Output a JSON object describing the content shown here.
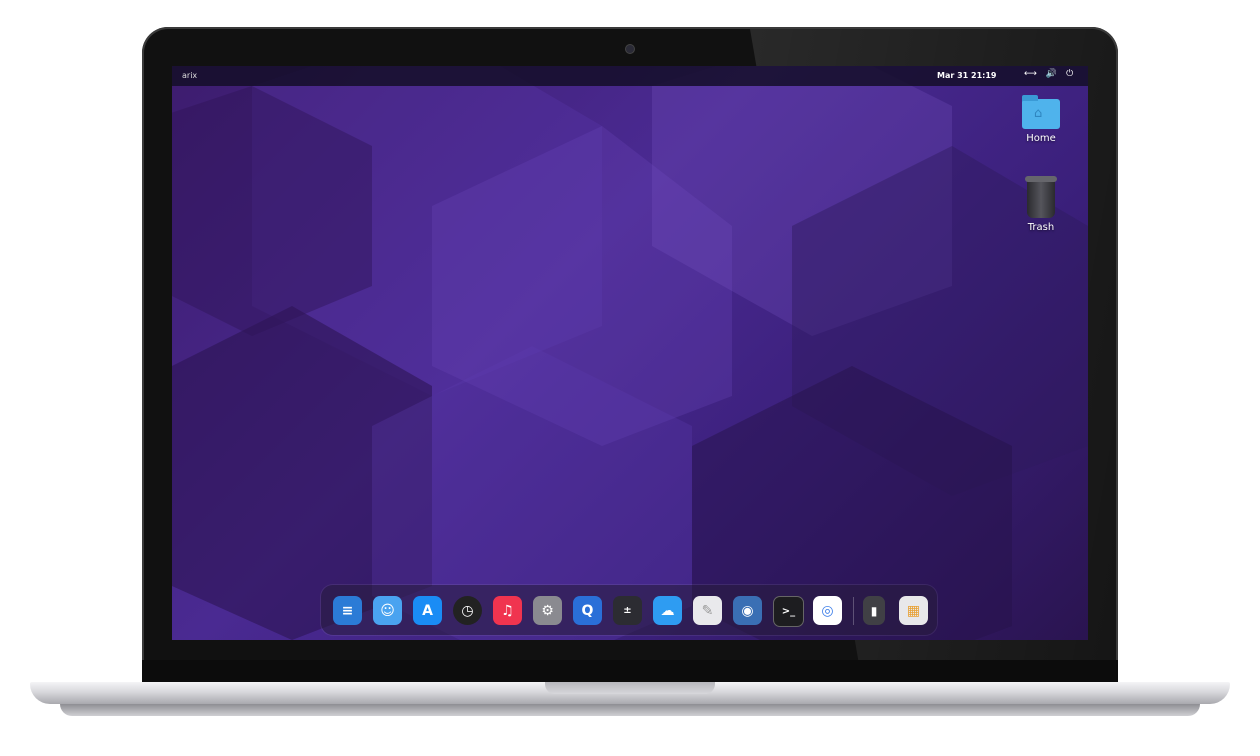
{
  "topbar": {
    "distro": "arix",
    "datetime": "Mar 31  21:19",
    "network_icon": "network-icon",
    "volume_icon": "volume-icon",
    "power_icon": "power-icon"
  },
  "desktop": {
    "home_label": "Home",
    "trash_label": "Trash"
  },
  "dock": {
    "items": [
      {
        "name": "dock-text-editor",
        "icon": "document-icon",
        "color": "#2b7bd6"
      },
      {
        "name": "dock-finder",
        "icon": "finder-icon",
        "color": "#4aa3f0"
      },
      {
        "name": "dock-app-store",
        "icon": "app-store-icon",
        "color": "#1a8cf5"
      },
      {
        "name": "dock-clock",
        "icon": "clock-icon",
        "color": "#222222"
      },
      {
        "name": "dock-music",
        "icon": "music-icon",
        "color": "#f0344f"
      },
      {
        "name": "dock-settings",
        "icon": "settings-icon",
        "color": "#8a8a90"
      },
      {
        "name": "dock-quicktime",
        "icon": "quicktime-icon",
        "color": "#2a6fd8"
      },
      {
        "name": "dock-calculator",
        "icon": "calculator-icon",
        "color": "#2c2c32"
      },
      {
        "name": "dock-weather",
        "icon": "weather-icon",
        "color": "#2e9cf2"
      },
      {
        "name": "dock-notes",
        "icon": "notes-icon",
        "color": "#e9e9ec"
      },
      {
        "name": "dock-users",
        "icon": "users-icon",
        "color": "#3a6fb4"
      },
      {
        "name": "dock-terminal",
        "icon": "terminal-icon",
        "color": "#1d1d20"
      },
      {
        "name": "dock-browser",
        "icon": "browser-icon",
        "color": "#3b7de8"
      },
      {
        "name": "dock-trash",
        "icon": "trash-icon",
        "color": "#404045"
      },
      {
        "name": "dock-launchpad",
        "icon": "launchpad-icon",
        "color": "#e8e8ea"
      }
    ]
  }
}
